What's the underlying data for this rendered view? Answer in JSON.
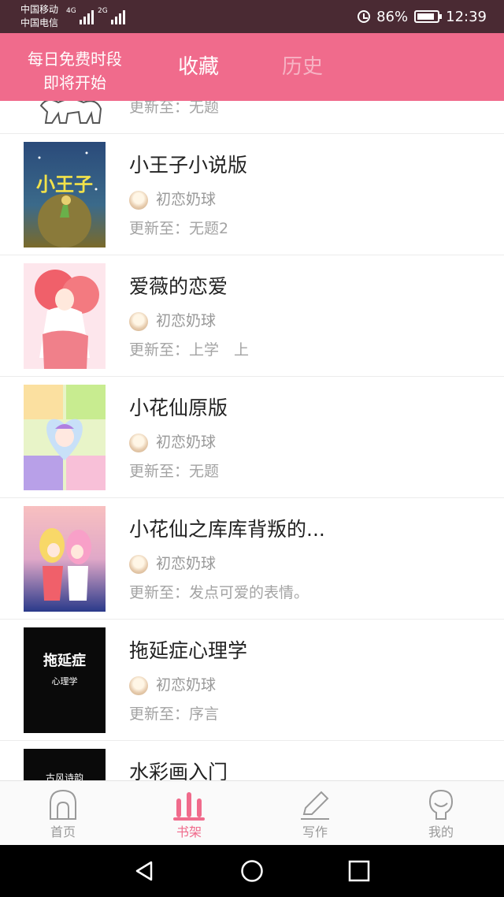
{
  "status_bar": {
    "carrier_1": "中国移动",
    "carrier_2": "中国电信",
    "net_1": "4G",
    "net_2": "2G",
    "battery_percent": "86%",
    "battery_level": 0.86,
    "time": "12:39"
  },
  "header": {
    "promo_line1": "每日免费时段",
    "promo_line2": "即将开始",
    "tabs": [
      {
        "label": "收藏",
        "active": true
      },
      {
        "label": "历史",
        "active": false
      }
    ]
  },
  "books": [
    {
      "title": "",
      "author": "",
      "update": "更新至：无题"
    },
    {
      "title": "小王子小说版",
      "author": "初恋奶球",
      "update": "更新至：无题2",
      "cover_text": "小王子"
    },
    {
      "title": "爱薇的恋爱",
      "author": "初恋奶球",
      "update": "更新至：上学　上"
    },
    {
      "title": "小花仙原版",
      "author": "初恋奶球",
      "update": "更新至：无题"
    },
    {
      "title": "小花仙之库库背叛的...",
      "author": "初恋奶球",
      "update": "更新至：发点可爱的表情。"
    },
    {
      "title": "拖延症心理学",
      "author": "初恋奶球",
      "update": "更新至：序言",
      "cover_title": "拖延症",
      "cover_sub": "心理学"
    },
    {
      "title": "水彩画入门",
      "author": "",
      "update": "",
      "cover_title": "古风诗韵"
    }
  ],
  "tabbar": {
    "items": [
      {
        "label": "首页",
        "icon": "home-icon",
        "active": false
      },
      {
        "label": "书架",
        "icon": "bookshelf-icon",
        "active": true
      },
      {
        "label": "写作",
        "icon": "pencil-icon",
        "active": false
      },
      {
        "label": "我的",
        "icon": "profile-icon",
        "active": false
      }
    ]
  },
  "colors": {
    "accent": "#f06b8c",
    "status_bar": "#4a2a33",
    "tab_inactive": "#f6b3c4"
  }
}
